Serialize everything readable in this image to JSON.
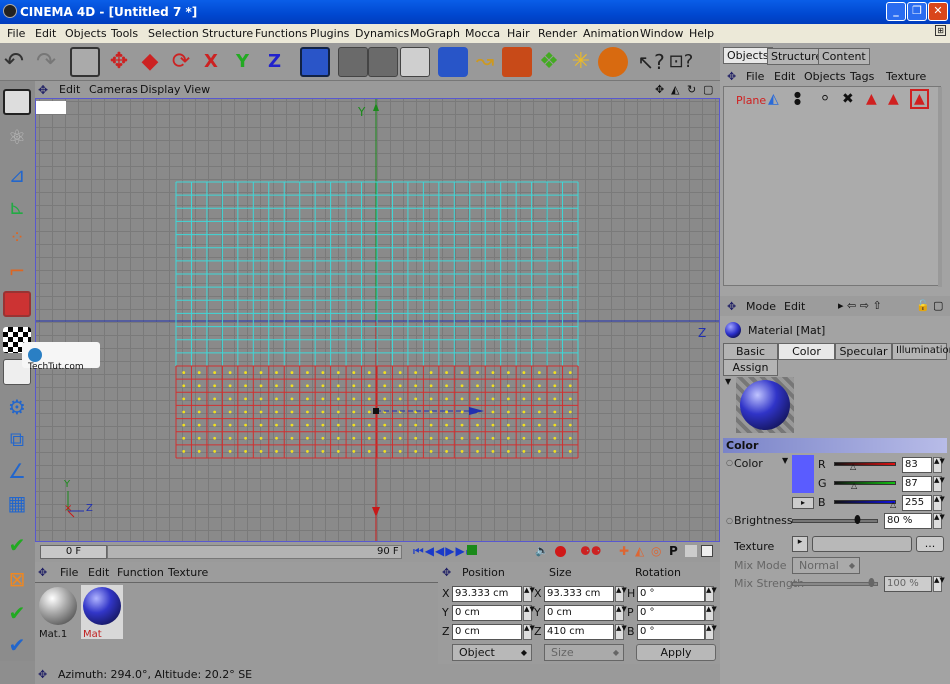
{
  "window": {
    "title": "CINEMA 4D - [Untitled 7 *]"
  },
  "menu": [
    "File",
    "Edit",
    "Objects",
    "Tools",
    "Selection",
    "Structure",
    "Functions",
    "Plugins",
    "Dynamics",
    "MoGraph",
    "Mocca",
    "Hair",
    "Render",
    "Animation",
    "Window",
    "Help"
  ],
  "viewport": {
    "menu": [
      "Edit",
      "Cameras",
      "Display",
      "View"
    ],
    "axis_labels": {
      "y": "Y",
      "z": "Z"
    },
    "gizmo": {
      "y": "Y",
      "z": "Z"
    },
    "watermark": "TechTut.com"
  },
  "timeline": {
    "current": "0 F",
    "end": "90 F"
  },
  "material_manager": {
    "menu": [
      "File",
      "Edit",
      "Function",
      "Texture"
    ],
    "materials": [
      {
        "name": "Mat.1"
      },
      {
        "name": "Mat"
      }
    ]
  },
  "coordinates": {
    "headers": {
      "position": "Position",
      "size": "Size",
      "rotation": "Rotation"
    },
    "rows": [
      {
        "axis": "X",
        "pos": "93.333 cm",
        "saxis": "X",
        "size": "93.333 cm",
        "raxis": "H",
        "rot": "0 °"
      },
      {
        "axis": "Y",
        "pos": "0 cm",
        "saxis": "Y",
        "size": "0 cm",
        "raxis": "P",
        "rot": "0 °"
      },
      {
        "axis": "Z",
        "pos": "0 cm",
        "saxis": "Z",
        "size": "410 cm",
        "raxis": "B",
        "rot": "0 °"
      }
    ],
    "mode": "Object",
    "size_mode": "Size",
    "apply": "Apply"
  },
  "status": "Azimuth: 294.0°, Altitude: 20.2° SE",
  "objects_panel": {
    "tabs": [
      "Objects",
      "Structure",
      "Content"
    ],
    "menu": [
      "File",
      "Edit",
      "Objects",
      "Tags",
      "Texture"
    ],
    "object": "Plane"
  },
  "attributes": {
    "menu": [
      "Mode",
      "Edit"
    ],
    "title": "Material [Mat]",
    "tabs": [
      "Basic",
      "Color",
      "Specular",
      "Illumination"
    ],
    "assign": "Assign",
    "section": "Color",
    "color_label": "Color",
    "r_label": "R",
    "g_label": "G",
    "b_label": "B",
    "r": "83",
    "g": "87",
    "b": "255",
    "brightness_label": "Brightness",
    "brightness": "80 %",
    "texture_label": "Texture",
    "texture_btn": "...",
    "mix_mode_label": "Mix Mode",
    "mix_mode": "Normal",
    "mix_strength_label": "Mix Strength",
    "mix_strength": "100 %",
    "swatch": "#5a5cff"
  }
}
